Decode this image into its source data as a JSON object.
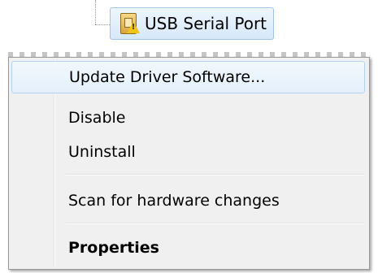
{
  "tree_node": {
    "label": "USB Serial Port",
    "icon": "usb-device-warning-icon"
  },
  "context_menu": {
    "items": [
      {
        "label": "Update Driver Software...",
        "highlighted": true,
        "bold": false
      },
      {
        "label": "Disable",
        "highlighted": false,
        "bold": false
      },
      {
        "label": "Uninstall",
        "highlighted": false,
        "bold": false
      },
      {
        "label": "Scan for hardware changes",
        "highlighted": false,
        "bold": false
      },
      {
        "label": "Properties",
        "highlighted": false,
        "bold": true
      }
    ]
  },
  "colors": {
    "menu_background": "#f0f0f0",
    "highlight_border": "#b5d3f1",
    "warning_yellow": "#f0c419"
  }
}
